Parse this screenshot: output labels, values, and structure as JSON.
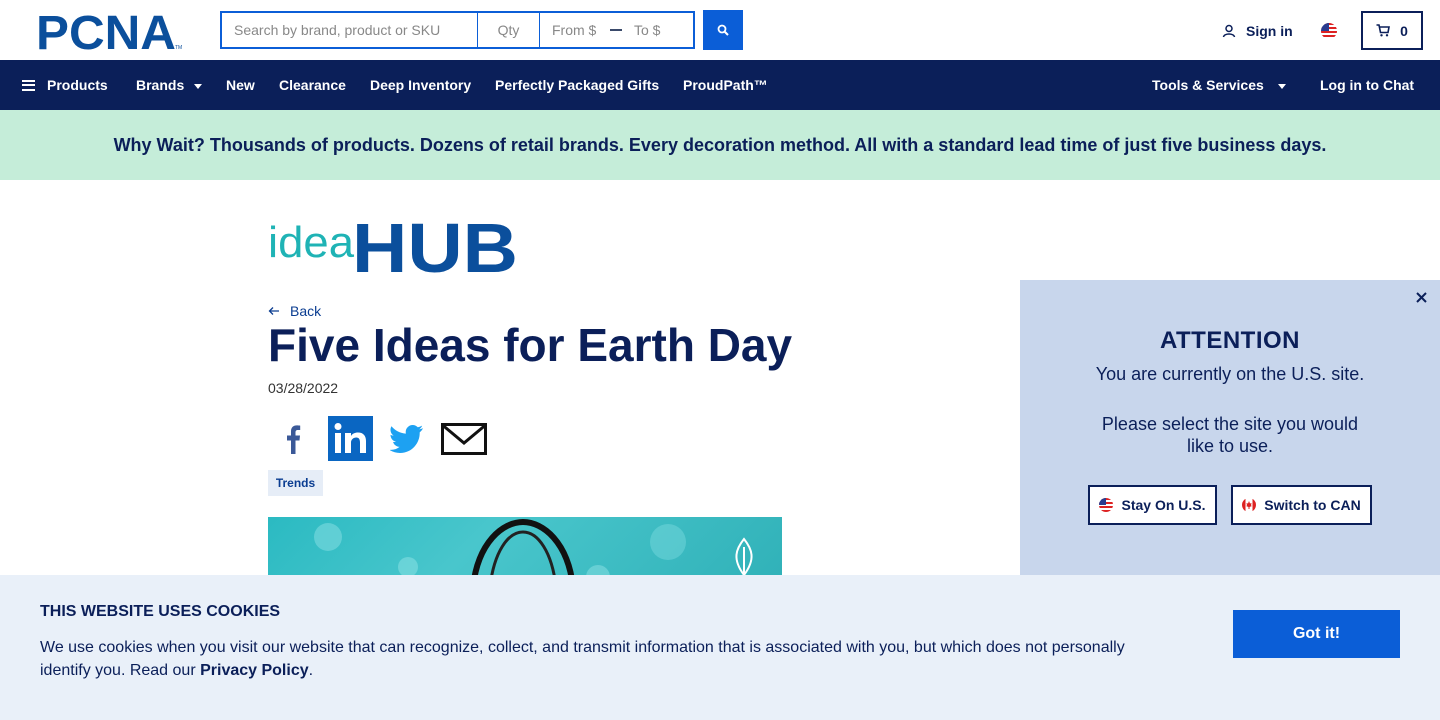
{
  "header": {
    "logo_text": "PCNA",
    "logo_tm": "TM",
    "search": {
      "placeholder": "Search by brand, product or SKU",
      "qty_placeholder": "Qty",
      "from_placeholder": "From $",
      "to_placeholder": "To $"
    },
    "sign_in_label": "Sign in",
    "cart_count": "0"
  },
  "nav": {
    "products": "Products",
    "brands": "Brands",
    "new": "New",
    "clearance": "Clearance",
    "deep_inventory": "Deep Inventory",
    "gifts": "Perfectly Packaged Gifts",
    "proudpath": "ProudPath™",
    "tools": "Tools & Services",
    "chat": "Log in to Chat"
  },
  "promo": {
    "text": "Why Wait? Thousands of products. Dozens of retail brands. Every decoration method. All with a standard lead time of just five business days."
  },
  "article": {
    "brand_idea": "idea",
    "brand_hub": "HUB",
    "back_label": "Back",
    "title": "Five Ideas for Earth Day",
    "date": "03/28/2022",
    "tag": "Trends"
  },
  "attention": {
    "title": "ATTENTION",
    "line1": "You are currently on the U.S. site.",
    "line2": "Please select the site you would like to use.",
    "stay_label": "Stay On U.S.",
    "switch_label": "Switch to CAN"
  },
  "cookie": {
    "title": "THIS WEBSITE USES COOKIES",
    "text": "We use cookies when you visit our website that can recognize, collect, and transmit information that is associated with you, but which does not personally identify you. Read our ",
    "link": "Privacy Policy",
    "end": ".",
    "button": "Got it!"
  },
  "colors": {
    "navy": "#0b1f59",
    "brand_blue": "#0b5ed7",
    "promo_green": "#c5edd9",
    "teal": "#1fb3b5"
  },
  "icons": [
    "search-icon",
    "user-icon",
    "us-flag-icon",
    "cart-icon",
    "menu-icon",
    "back-arrow-icon",
    "facebook-icon",
    "linkedin-icon",
    "twitter-icon",
    "mail-icon",
    "close-icon",
    "canada-flag-icon",
    "leaf-icon"
  ]
}
